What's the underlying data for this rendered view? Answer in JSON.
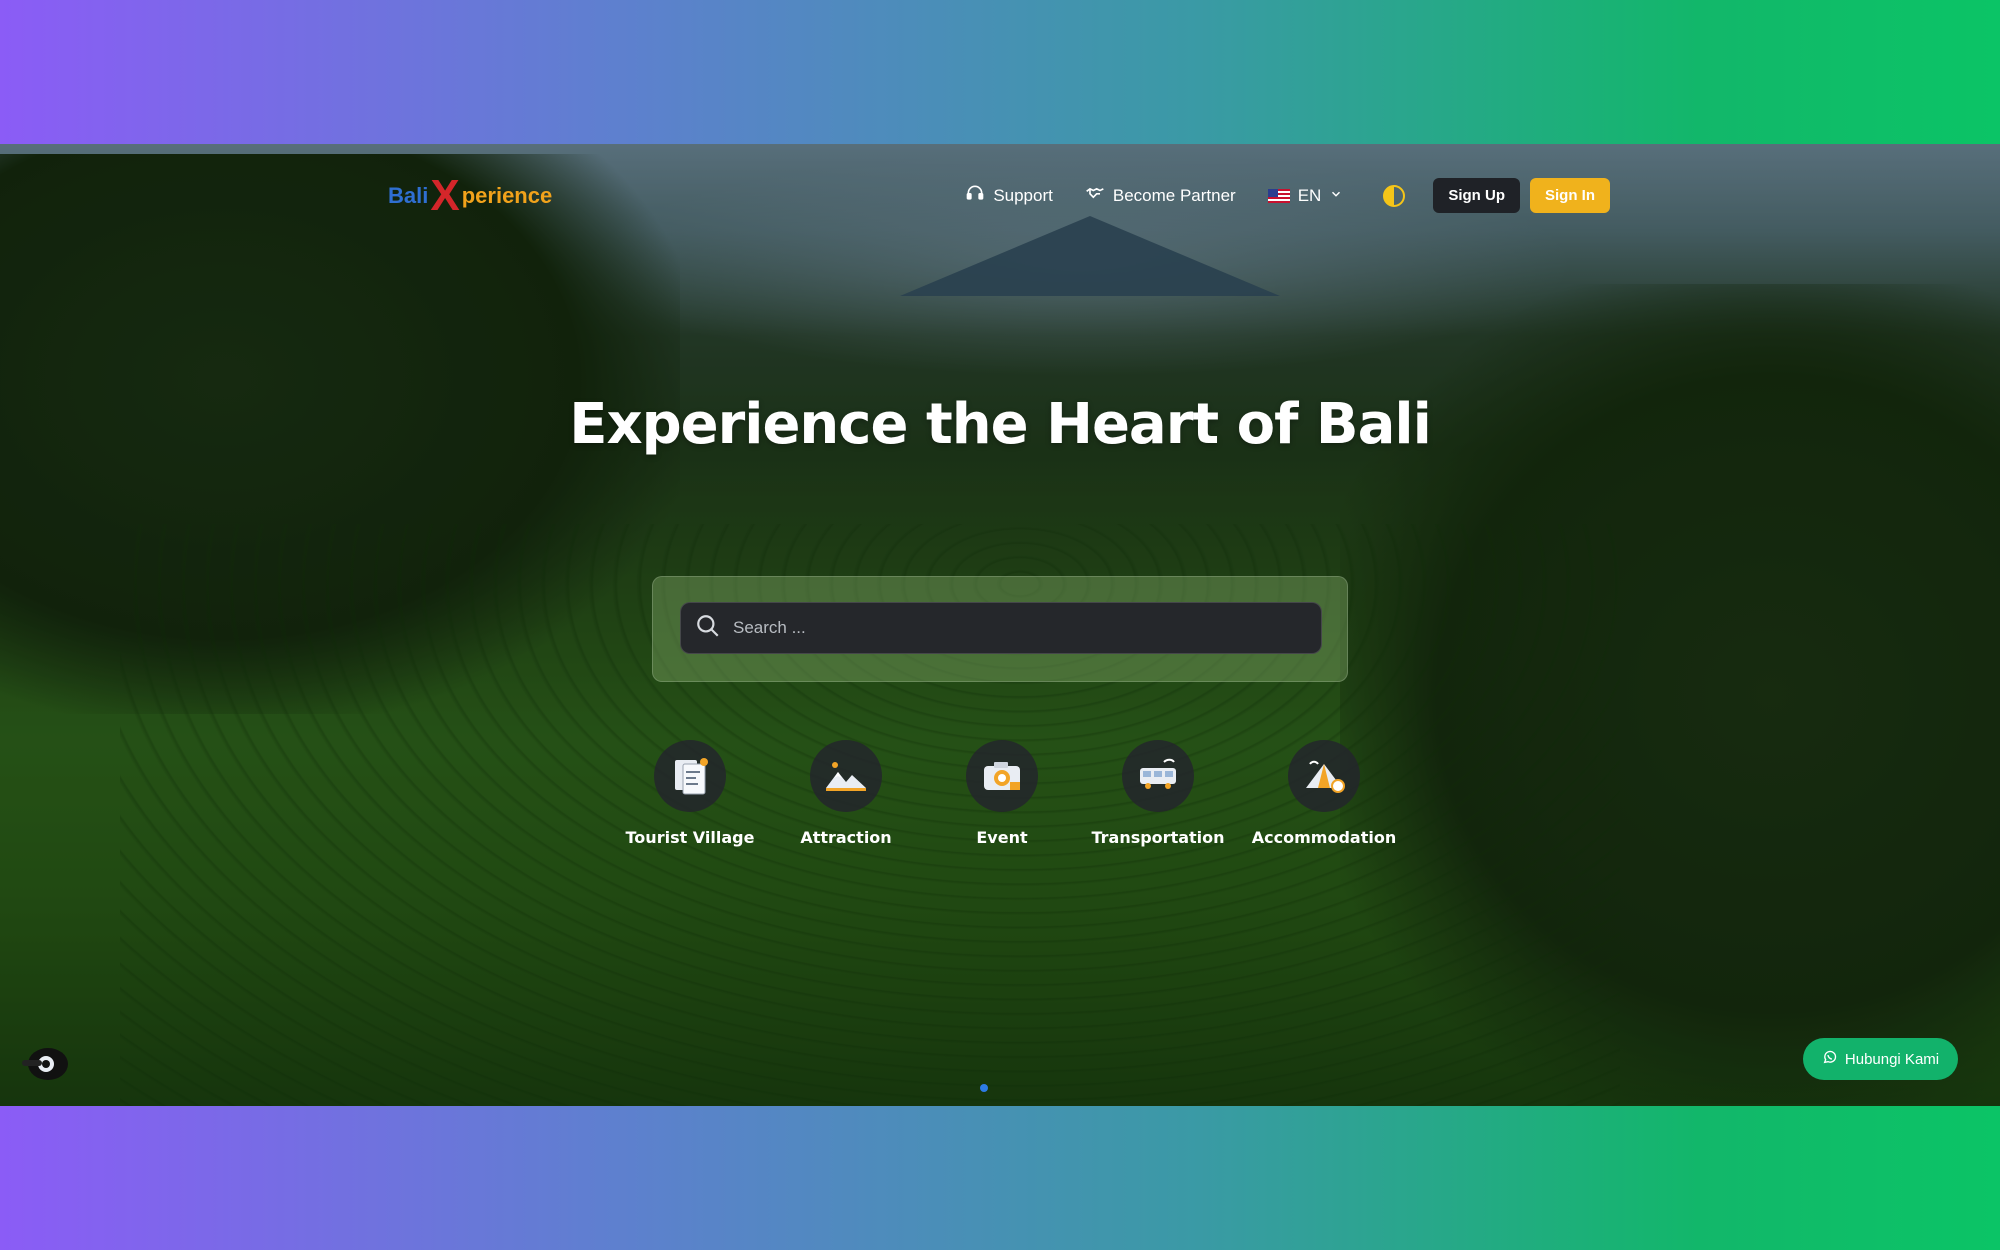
{
  "brand": {
    "logo_b": "B",
    "logo_ali": "ali",
    "logo_x": "X",
    "logo_perience": "perience",
    "colors": {
      "blue": "#2f6fd1",
      "red": "#d4262a",
      "orange": "#f1a21b"
    }
  },
  "nav": {
    "support": {
      "label": "Support",
      "icon": "headset-icon"
    },
    "partner": {
      "label": "Become Partner",
      "icon": "handshake-icon"
    },
    "language": {
      "label": "EN",
      "icon": "us-flag-icon"
    },
    "theme_icon": "contrast-toggle-icon",
    "signup_label": "Sign Up",
    "signin_label": "Sign In"
  },
  "hero": {
    "title": "Experience the Heart of Bali"
  },
  "search": {
    "placeholder": "Search ..."
  },
  "categories": [
    {
      "label": "Tourist Village",
      "icon": "map-brochure-icon"
    },
    {
      "label": "Attraction",
      "icon": "mountain-icon"
    },
    {
      "label": "Event",
      "icon": "camera-icon"
    },
    {
      "label": "Transportation",
      "icon": "bus-icon"
    },
    {
      "label": "Accommodation",
      "icon": "tent-icon"
    }
  ],
  "whatsapp": {
    "label": "Hubungi Kami",
    "icon": "whatsapp-icon"
  },
  "colors": {
    "accent_yellow": "#f0b21c",
    "dark_button": "#1f2227",
    "whatsapp_green": "#12b26b",
    "carousel_dot": "#2d7be5"
  }
}
